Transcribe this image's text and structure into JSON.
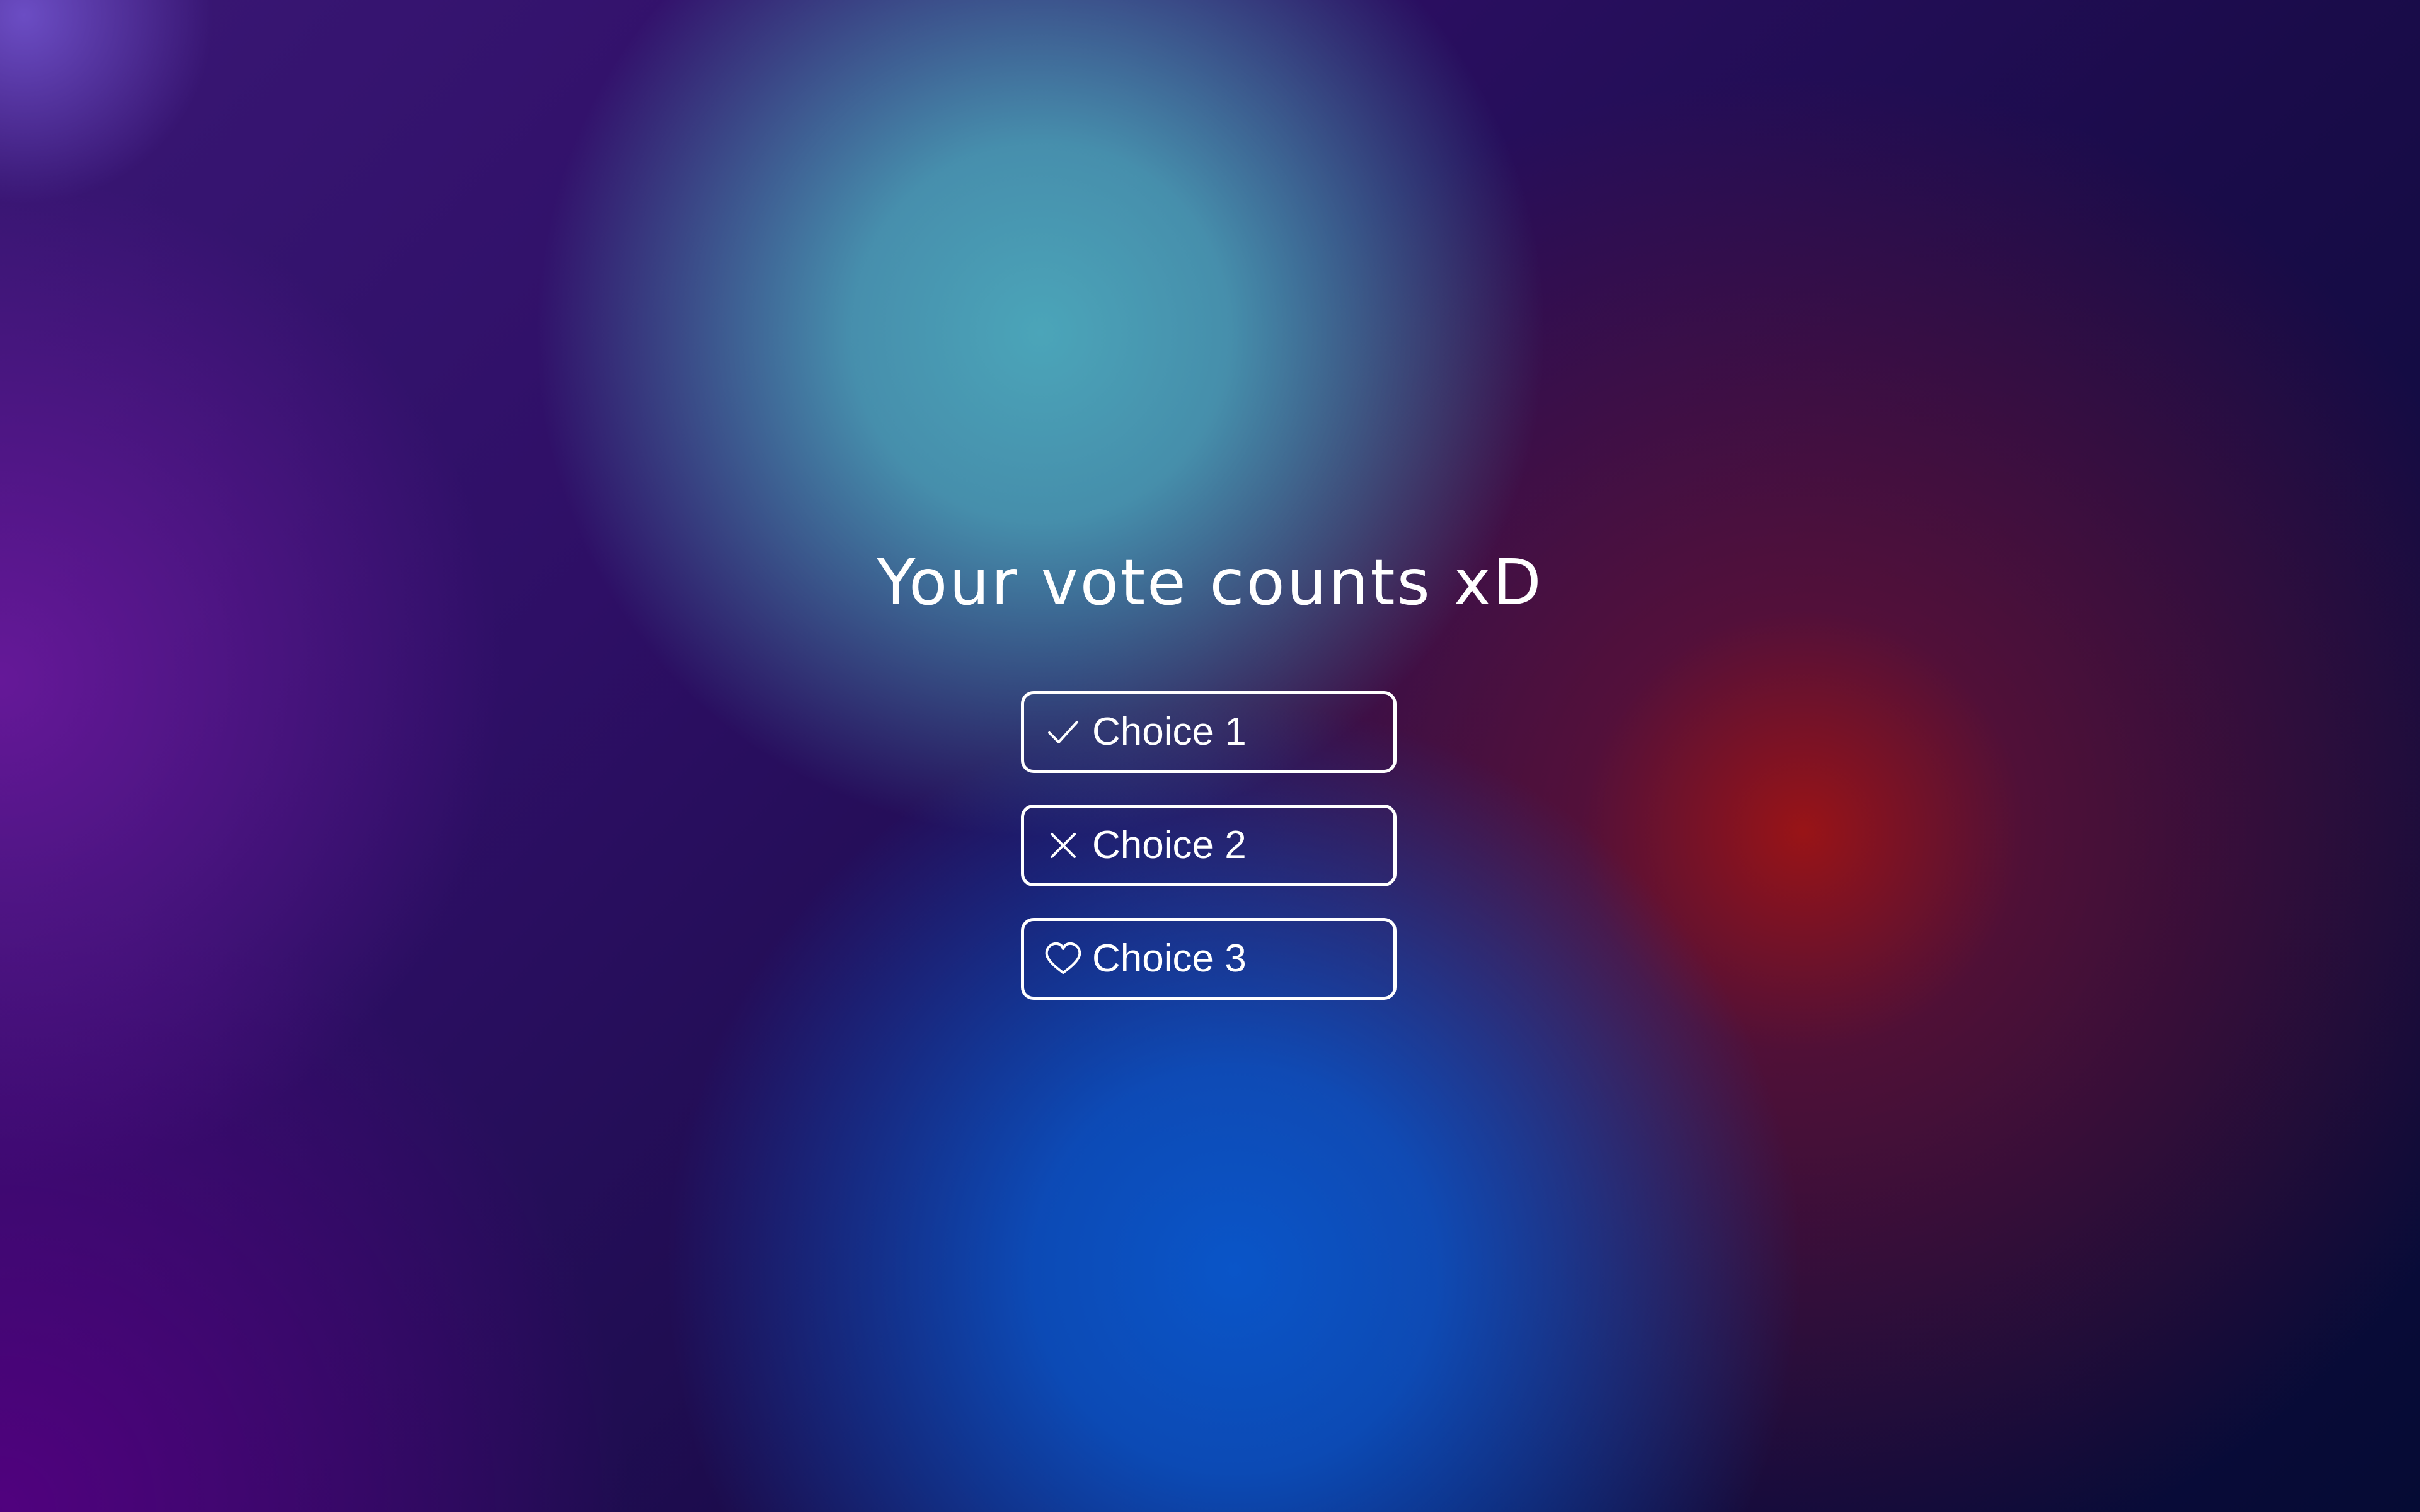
{
  "title": "Your vote counts xD",
  "choices": [
    {
      "label": "Choice 1",
      "icon": "check-icon"
    },
    {
      "label": "Choice 2",
      "icon": "close-icon"
    },
    {
      "label": "Choice 3",
      "icon": "heart-icon"
    }
  ],
  "colors": {
    "text": "#ffffff",
    "button_border": "#ffffff",
    "background_teal": "#4ba5b9",
    "background_blue": "#0a55c8",
    "background_red": "#a01414",
    "background_purple": "#2e0f66",
    "background_navy": "#050b34"
  }
}
